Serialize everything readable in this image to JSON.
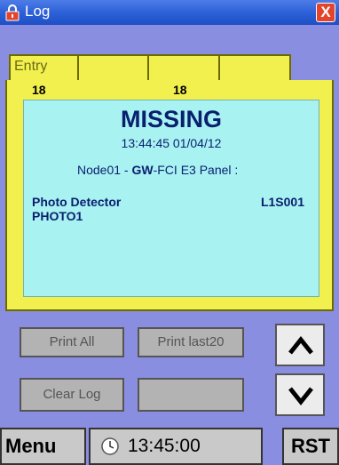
{
  "window": {
    "title": "Log",
    "close_label": "X"
  },
  "tabs": [
    {
      "label": "Entry"
    },
    {
      "label": ""
    },
    {
      "label": ""
    },
    {
      "label": ""
    }
  ],
  "counts": {
    "left": "18",
    "right": "18"
  },
  "entry": {
    "status": "MISSING",
    "timestamp": "13:44:45 01/04/12",
    "node_prefix": "Node01 - ",
    "node_bold": "GW",
    "node_suffix": "-FCI E3 Panel :",
    "device_type": "Photo Detector",
    "device_address": "L1S001",
    "device_label": "PHOTO1"
  },
  "buttons": {
    "print_all": "Print All",
    "print_last": "Print last20",
    "clear_log": "Clear Log",
    "blank": ""
  },
  "nav": {
    "up_icon": "arrow-up-icon",
    "down_icon": "arrow-down-icon"
  },
  "bottom": {
    "menu": "Menu",
    "clock": "13:45:00",
    "rst": "RST"
  },
  "colors": {
    "background": "#8a8ee0",
    "titlebar": "#2a5fd6",
    "tab_yellow": "#f2f04f",
    "entry_cyan": "#a9f2f2",
    "button_gray": "#b3b3b3"
  }
}
